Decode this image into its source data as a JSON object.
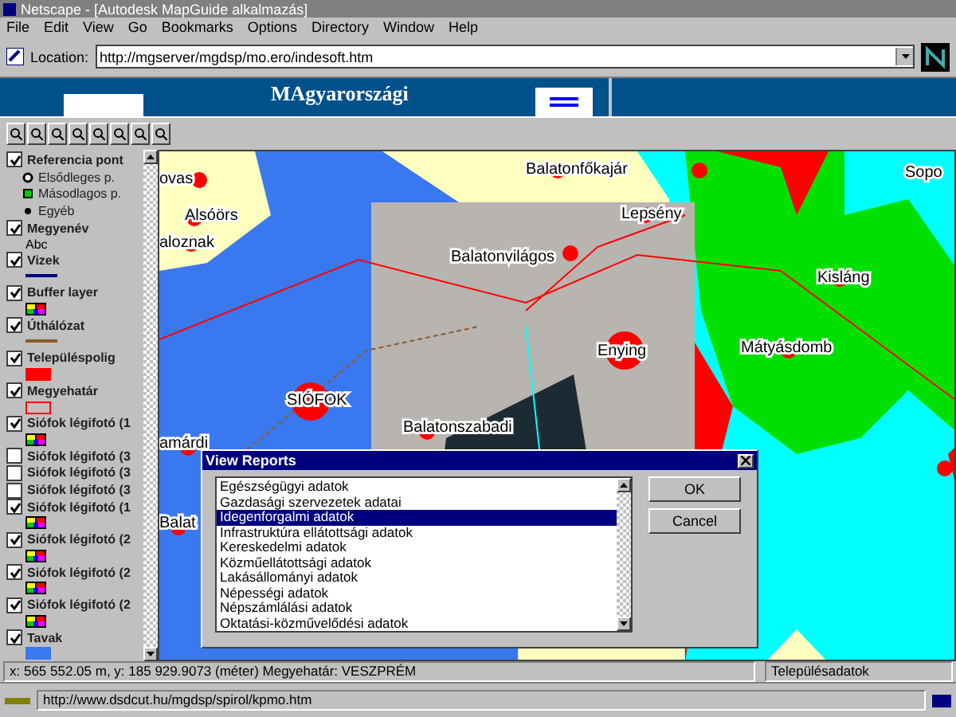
{
  "window": {
    "title": "Netscape - [Autodesk MapGuide alkalmazás]"
  },
  "menu": [
    "File",
    "Edit",
    "View",
    "Go",
    "Bookmarks",
    "Options",
    "Directory",
    "Window",
    "Help"
  ],
  "location": {
    "label": "Location:",
    "value": "http://mgserver/mgdsp/mo.ero/indesoft.htm"
  },
  "banner": {
    "title": "MAgyarországi"
  },
  "legend": [
    {
      "label": "Referencia pont",
      "checked": true,
      "children": [
        {
          "label": "Elsődleges p.",
          "kind": "ring"
        },
        {
          "label": "Másodlagos p.",
          "kind": "square"
        },
        {
          "label": "Egyéb",
          "kind": "dot"
        }
      ]
    },
    {
      "label": "Megyenév",
      "checked": true,
      "kind": "text",
      "sample": "Abc"
    },
    {
      "label": "Vizek",
      "checked": true,
      "kind": "line",
      "color": "#000080"
    },
    {
      "label": "Buffer layer",
      "checked": true,
      "kind": "multi"
    },
    {
      "label": "Úthálózat",
      "checked": true,
      "kind": "line",
      "color": "#8b5a2b"
    },
    {
      "label": "Településpolig",
      "checked": true,
      "kind": "fill",
      "color": "#ff0000"
    },
    {
      "label": "Megyehatár",
      "checked": true,
      "kind": "outline",
      "color": "#ff0000"
    },
    {
      "label": "Siófok légifotó (1",
      "checked": true,
      "kind": "multi"
    },
    {
      "label": "Siófok légifotó (3",
      "checked": false
    },
    {
      "label": "Siófok légifotó (3",
      "checked": false
    },
    {
      "label": "Siófok légifotó (3",
      "checked": false
    },
    {
      "label": "Siófok légifotó (1",
      "checked": true,
      "kind": "multi"
    },
    {
      "label": "Siófok légifotó (2",
      "checked": true,
      "kind": "multi"
    },
    {
      "label": "Siófok légifotó (2",
      "checked": true,
      "kind": "multi"
    },
    {
      "label": "Siófok légifotó (2",
      "checked": true,
      "kind": "multi"
    },
    {
      "label": "Tavak",
      "checked": true,
      "kind": "fill",
      "color": "#3a78f0"
    }
  ],
  "map": {
    "labels": [
      {
        "text": "ovas"
      },
      {
        "text": "Alsóörs"
      },
      {
        "text": "aloznak"
      },
      {
        "text": "Balatonfőkajár"
      },
      {
        "text": "Lepsény"
      },
      {
        "text": "Balatonvilágos"
      },
      {
        "text": "Kisláng"
      },
      {
        "text": "Enying"
      },
      {
        "text": "Mátyásdomb"
      },
      {
        "text": "SIÓFOK"
      },
      {
        "text": "Balatonszabadi"
      },
      {
        "text": "amárdi"
      },
      {
        "text": "Sopo"
      },
      {
        "text": "Balat"
      }
    ]
  },
  "dialog": {
    "title": "View Reports",
    "items": [
      {
        "label": "Egészségügyi adatok",
        "selected": false
      },
      {
        "label": "Gazdasági szervezetek adatai",
        "selected": false
      },
      {
        "label": "Idegenforgalmi adatok",
        "selected": true
      },
      {
        "label": "Infrastruktúra ellátottsági adatok",
        "selected": false
      },
      {
        "label": "Kereskedelmi adatok",
        "selected": false
      },
      {
        "label": "Közműellátottsági adatok",
        "selected": false
      },
      {
        "label": "Lakásállományi adatok",
        "selected": false
      },
      {
        "label": "Népességi adatok",
        "selected": false
      },
      {
        "label": "Népszámlálási adatok",
        "selected": false
      },
      {
        "label": "Oktatási-közművelődési adatok",
        "selected": false
      }
    ],
    "buttons": [
      "OK",
      "Cancel"
    ]
  },
  "map_status": {
    "coords": "x: 565 552.05 m, y: 185 929.9073 (méter)  Megyehatár: VESZPRÉM",
    "info": "Településadatok"
  },
  "status_bar": {
    "url": "http://www.dsdcut.hu/mgdsp/spirol/kpmo.htm"
  }
}
